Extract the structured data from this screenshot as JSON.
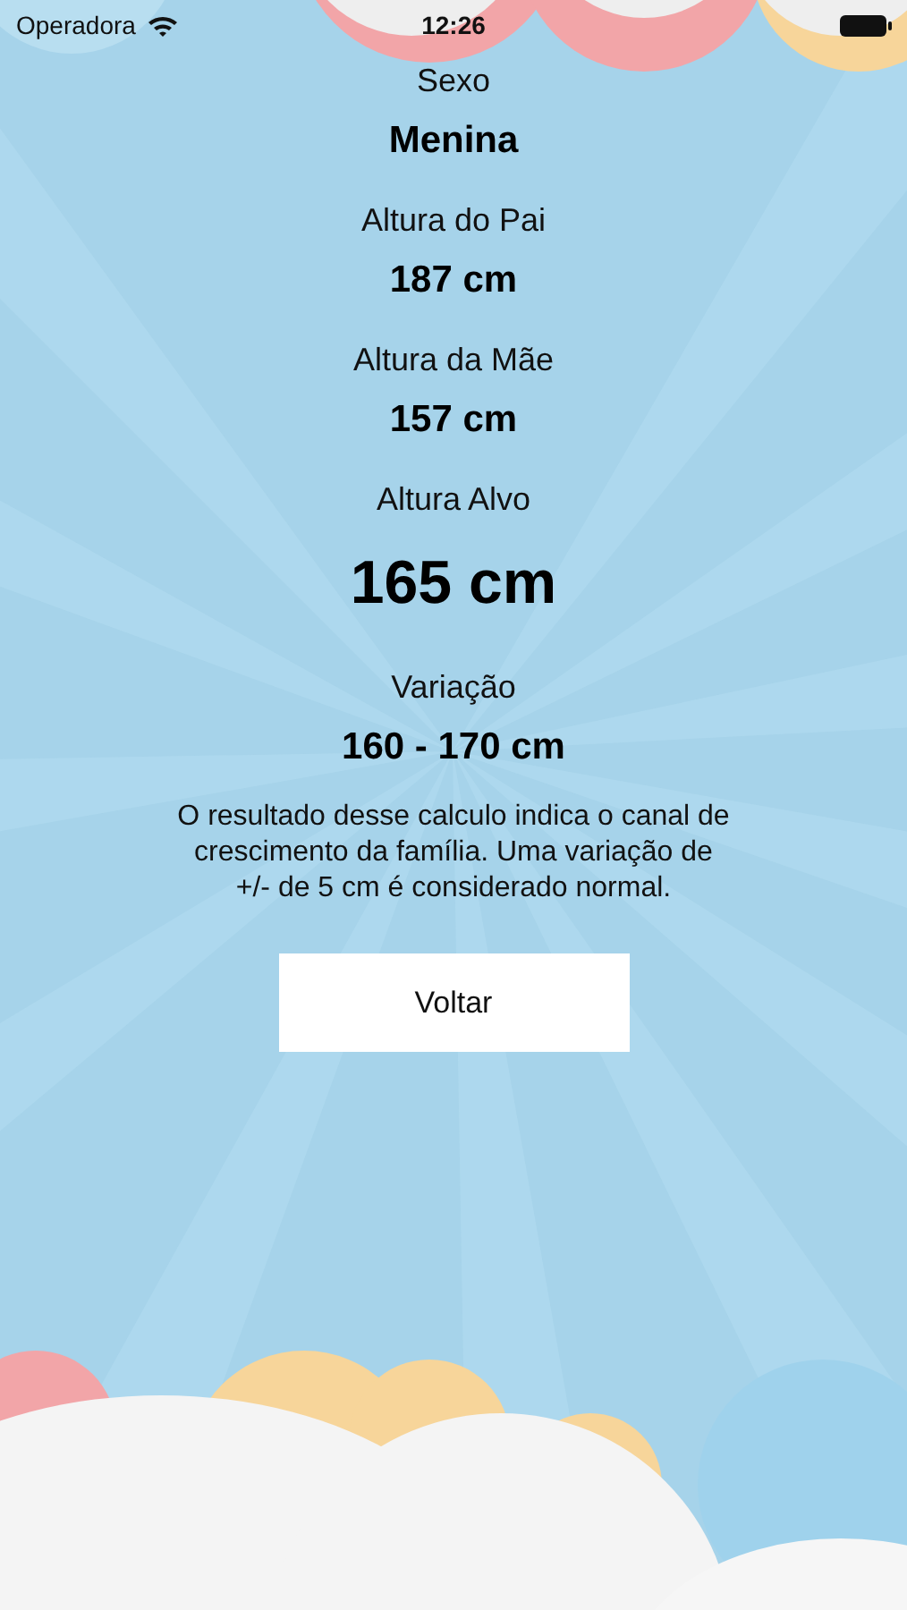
{
  "status_bar": {
    "carrier": "Operadora",
    "time": "12:26"
  },
  "results": [
    {
      "label": "Sexo",
      "value": "Menina",
      "kind": "normal"
    },
    {
      "label": "Altura do Pai",
      "value": "187 cm",
      "kind": "normal"
    },
    {
      "label": "Altura da Mãe",
      "value": "157 cm",
      "kind": "normal"
    },
    {
      "label": "Altura Alvo",
      "value": "165 cm",
      "kind": "highlight"
    },
    {
      "label": "Variação",
      "value": "160 - 170 cm",
      "kind": "normal"
    }
  ],
  "note": "O resultado desse calculo indica o canal de crescimento da família. Uma variação de +/- de 5 cm é considerado normal.",
  "button": {
    "label": "Voltar"
  }
}
